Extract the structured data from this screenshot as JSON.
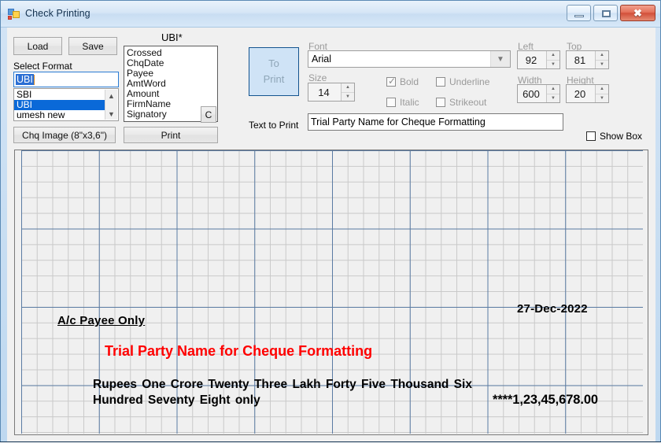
{
  "window": {
    "title": "Check Printing",
    "icon": "app-form-icon",
    "buttons": {
      "minimize": "minimize-icon",
      "maximize": "maximize-icon",
      "close": "✖"
    }
  },
  "toolbar": {
    "load_label": "Load",
    "save_label": "Save",
    "chq_image_label": "Chq Image (8\"x3,6\")",
    "print_label": "Print",
    "clear_label": "C",
    "to_print_line1": "To",
    "to_print_line2": "Print"
  },
  "format": {
    "select_format_label": "Select Format",
    "combo_value": "UBI",
    "options": [
      "SBI",
      "UBI",
      "umesh new"
    ],
    "selected_index": 1,
    "scroll_up_icon": "chevron-up-icon",
    "scroll_down_icon": "chevron-down-icon"
  },
  "fields": {
    "title": "UBI*",
    "items": [
      "Crossed",
      "ChqDate",
      "Payee",
      "AmtWord",
      "Amount",
      "FirmName",
      "Signatory"
    ]
  },
  "font": {
    "font_label": "Font",
    "font_value": "Arial",
    "size_label": "Size",
    "size_value": "14",
    "bold_label": "Bold",
    "bold_checked": true,
    "italic_label": "Italic",
    "italic_checked": false,
    "underline_label": "Underline",
    "underline_checked": false,
    "strikeout_label": "Strikeout",
    "strikeout_checked": false,
    "dropdown_icon": "chevron-down-icon"
  },
  "geometry": {
    "left_label": "Left",
    "left_value": "92",
    "top_label": "Top",
    "top_value": "81",
    "width_label": "Width",
    "width_value": "600",
    "height_label": "Height",
    "height_value": "20"
  },
  "text_to_print": {
    "label": "Text to Print",
    "value": "Trial Party Name for Cheque Formatting"
  },
  "show_box": {
    "label": "Show Box",
    "checked": false
  },
  "cheque_preview": {
    "ac_payee": "A/c Payee Only",
    "date": "27-Dec-2022",
    "party_name": "Trial Party Name for Cheque Formatting",
    "amount_in_words": "Rupees One Crore Twenty Three Lakh Forty Five Thousand Six Hundred Seventy Eight  only",
    "amount_figures": "****1,23,45,678.00",
    "party_name_color": "#ff0000",
    "grid_major_color": "#5a7ba3",
    "grid_minor_color": "#c9c9c9"
  }
}
